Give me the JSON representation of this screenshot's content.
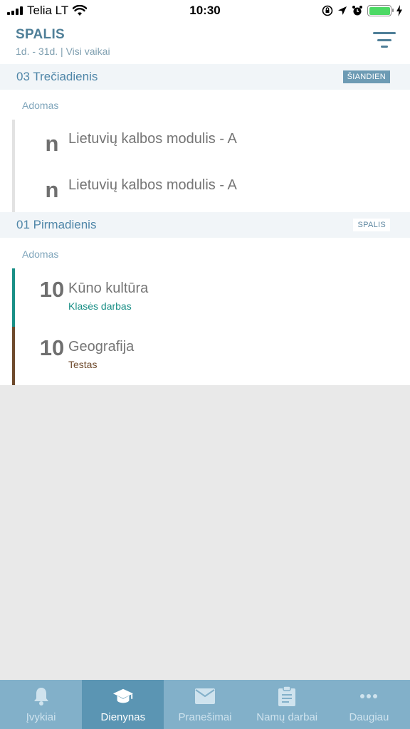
{
  "status_bar": {
    "carrier": "Telia LT",
    "time": "10:30"
  },
  "header": {
    "title": "SPALIS",
    "subtitle": "1d. - 31d. | Visi vaikai"
  },
  "days": [
    {
      "label": "03 Trečiadienis",
      "badge": "ŠIANDIEN",
      "child": "Adomas",
      "entries": [
        {
          "grade": "n",
          "subject": "Lietuvių kalbos modulis - A"
        },
        {
          "grade": "n",
          "subject": "Lietuvių kalbos modulis - A"
        }
      ]
    },
    {
      "label": "01 Pirmadienis",
      "badge": "SPALIS",
      "child": "Adomas",
      "entries": [
        {
          "grade": "10",
          "subject": "Kūno kultūra",
          "type": "Klasės darbas",
          "color": "#1a8f86"
        },
        {
          "grade": "10",
          "subject": "Geografija",
          "type": "Testas",
          "color": "#6e4a2c"
        }
      ]
    }
  ],
  "tabs": [
    {
      "label": "Įvykiai",
      "icon": "bell-icon"
    },
    {
      "label": "Dienynas",
      "icon": "graduation-cap-icon"
    },
    {
      "label": "Pranešimai",
      "icon": "envelope-icon"
    },
    {
      "label": "Namų darbai",
      "icon": "clipboard-icon"
    },
    {
      "label": "Daugiau",
      "icon": "more-dots-icon"
    }
  ],
  "colors": {
    "accent": "#4f7f98",
    "tab_bar": "#82b0c9",
    "tab_active": "#5b95b3"
  }
}
